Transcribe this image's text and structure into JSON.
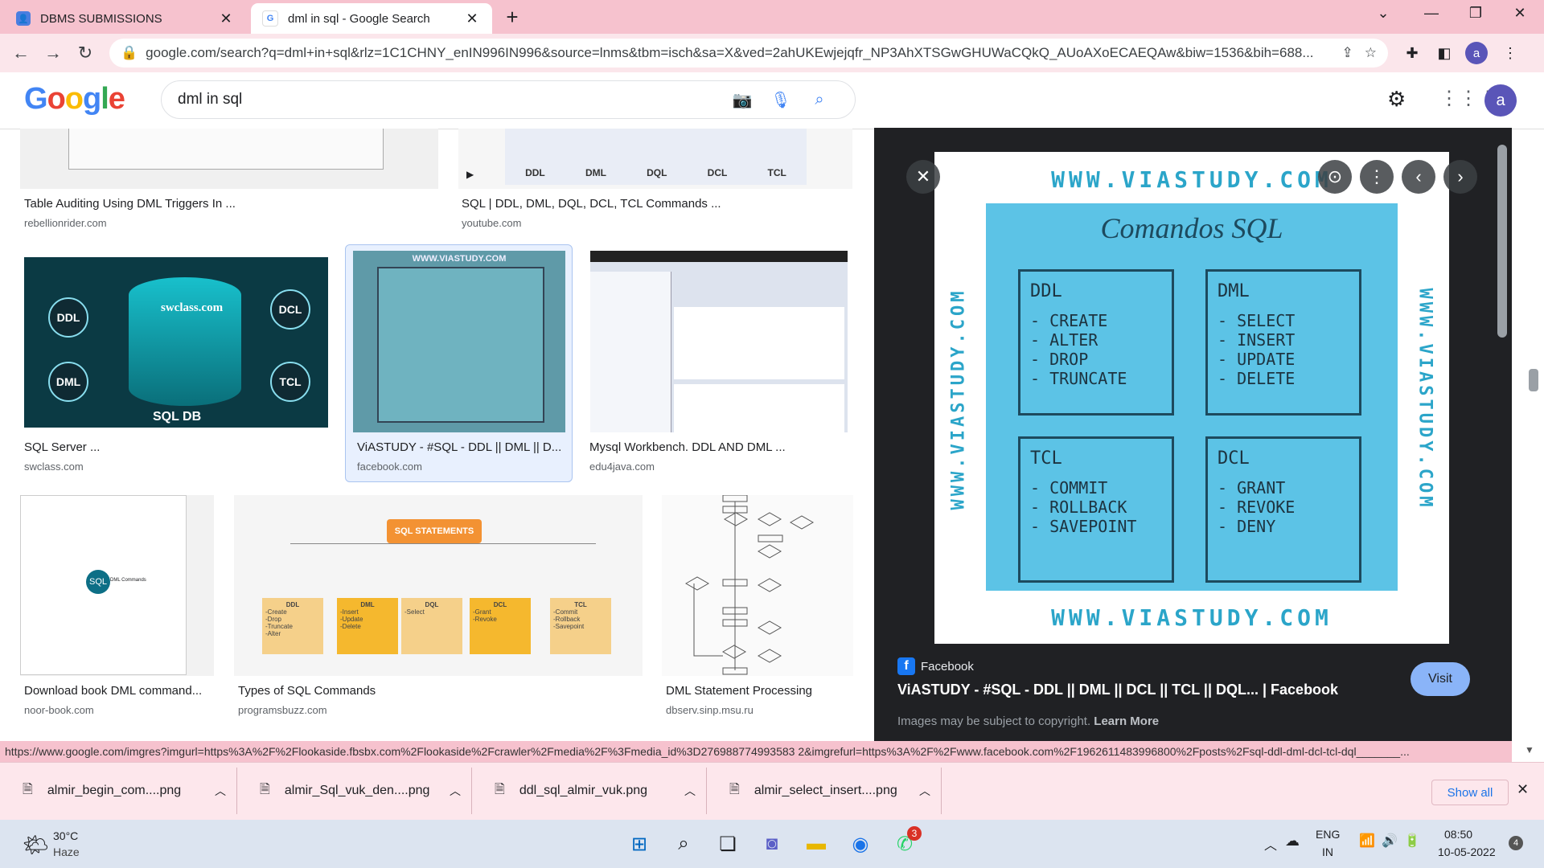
{
  "tabs": [
    {
      "label": "DBMS SUBMISSIONS",
      "favicon": "person-icon",
      "close": "✕"
    },
    {
      "label": "dml in sql - Google Search",
      "favicon": "google-icon",
      "close": "✕"
    }
  ],
  "new_tab": "+",
  "address_bar": {
    "url": "google.com/search?q=dml+in+sql&rlz=1C1CHNY_enIN996IN996&source=lnms&tbm=isch&sa=X&ved=2ahUKEwjejqfr_NP3AhXTSGwGHUWaCQkQ_AUoAXoECAEQAw&biw=1536&bih=688...",
    "avatar": "a"
  },
  "google": {
    "logo": "Google",
    "query": "dml in sql",
    "avatar": "a"
  },
  "results": [
    {
      "caption": "Table Auditing Using DML Triggers In ...",
      "source": "rebellionrider.com"
    },
    {
      "caption": "SQL | DDL, DML, DQL, DCL, TCL Commands ...",
      "source": "youtube.com",
      "labels": [
        "DDL",
        "DML",
        "DQL",
        "DCL",
        "TCL"
      ]
    },
    {
      "caption": "SQL Server ...",
      "source": "swclass.com",
      "labels": [
        "DDL",
        "DCL",
        "DML",
        "TCL",
        "swclass.com",
        "SQL DB"
      ]
    },
    {
      "caption": "ViASTUDY - #SQL - DDL || DML || D...",
      "source": "facebook.com"
    },
    {
      "caption": "Mysql Workbench. DDL AND DML ...",
      "source": "edu4java.com"
    },
    {
      "caption": "Download book DML command...",
      "source": "noor-book.com",
      "badge": "SQL",
      "sub": "DML Commands"
    },
    {
      "caption": "Types of SQL Commands",
      "source": "programsbuzz.com",
      "root": "SQL STATEMENTS",
      "boxes": [
        {
          "h": "DDL",
          "items": [
            "-Create",
            "-Drop",
            "-Truncate",
            "-Alter"
          ]
        },
        {
          "h": "DML",
          "items": [
            "-Insert",
            "-Update",
            "-Delete"
          ]
        },
        {
          "h": "DQL",
          "items": [
            "-Select"
          ]
        },
        {
          "h": "DCL",
          "items": [
            "-Grant",
            "-Revoke"
          ]
        },
        {
          "h": "TCL",
          "items": [
            "-Commit",
            "-Rollback",
            "-Savepoint"
          ]
        }
      ]
    },
    {
      "caption": "DML Statement Processing",
      "source": "dbserv.sinp.msu.ru"
    }
  ],
  "preview": {
    "site": "WWW.VIASTUDY.COM",
    "title": "Comandos SQL",
    "quads": [
      {
        "h": "DDL",
        "items": [
          "- CREATE",
          "- ALTER",
          "- DROP",
          "- TRUNCATE"
        ]
      },
      {
        "h": "DML",
        "items": [
          "- SELECT",
          "- INSERT",
          "- UPDATE",
          "- DELETE"
        ]
      },
      {
        "h": "TCL",
        "items": [
          "- COMMIT",
          "- ROLLBACK",
          "- SAVEPOINT"
        ]
      },
      {
        "h": "DCL",
        "items": [
          "- GRANT",
          "- REVOKE",
          "- DENY"
        ]
      }
    ],
    "source": "Facebook",
    "page_title": "ViASTUDY - #SQL - DDL || DML || DCL || TCL || DQL... | Facebook",
    "visit": "Visit",
    "copyright": "Images may be subject to copyright.",
    "learn_more": "Learn More"
  },
  "status_url": "https://www.google.com/imgres?imgurl=https%3A%2F%2Flookaside.fbsbx.com%2Flookaside%2Fcrawler%2Fmedia%2F%3Fmedia_id%3D276988774993583 2&imgrefurl=https%3A%2F%2Fwww.facebook.com%2F1962611483996800%2Fposts%2Fsql-ddl-dml-dcl-tcl-dql_______...",
  "downloads": [
    {
      "name": "almir_begin_com....png"
    },
    {
      "name": "almir_Sql_vuk_den....png"
    },
    {
      "name": "ddl_sql_almir_vuk.png"
    },
    {
      "name": "almir_select_insert....png"
    }
  ],
  "show_all": "Show all",
  "taskbar": {
    "weather_temp": "30°C",
    "weather_desc": "Haze",
    "whatsapp_badge": "3",
    "lang1": "ENG",
    "lang2": "IN",
    "time": "08:50",
    "date": "10-05-2022",
    "notif": "4"
  }
}
